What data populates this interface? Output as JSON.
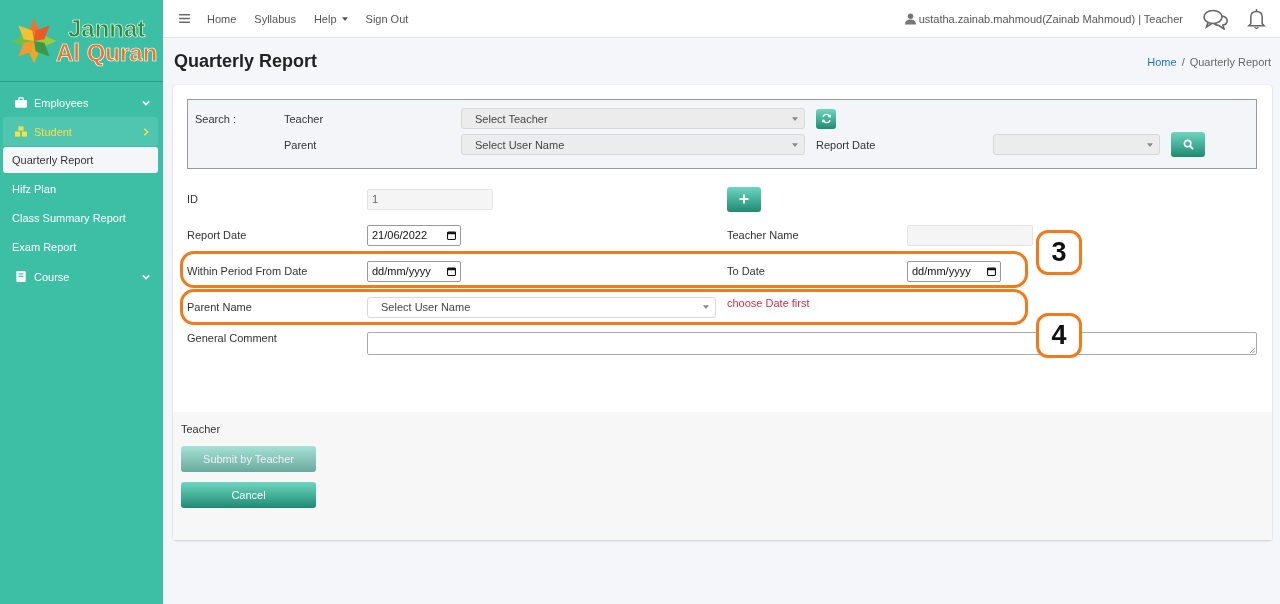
{
  "logo": {
    "line_1": "Jannat",
    "line_2": "Al Quran"
  },
  "sidebar": {
    "items": [
      {
        "label": "Employees",
        "selected": false
      },
      {
        "label": "Student",
        "selected": true,
        "children": [
          {
            "label": "Quarterly Report",
            "selected": true
          },
          {
            "label": "Hifz Plan",
            "selected": false
          },
          {
            "label": "Class Summary Report",
            "selected": false
          },
          {
            "label": "Exam Report",
            "selected": false
          }
        ]
      },
      {
        "label": "Course",
        "selected": false
      }
    ]
  },
  "topnav": {
    "items": [
      {
        "label": "Home",
        "dropdown": false
      },
      {
        "label": "Syllabus",
        "dropdown": false
      },
      {
        "label": "Help",
        "dropdown": true
      },
      {
        "label": "Sign Out",
        "dropdown": false
      }
    ],
    "user": "ustatha.zainab.mahmoud(Zainab Mahmoud) | Teacher"
  },
  "page_title": "Quarterly Report",
  "breadcrumb": {
    "separator": "/",
    "items": [
      {
        "label": "Home",
        "link": true
      },
      {
        "label": "Quarterly Report",
        "link": false
      }
    ]
  },
  "search": {
    "label": "Search :",
    "teacher_label": "Teacher",
    "teacher_select": "Select Teacher",
    "parent_label": "Parent",
    "parent_select": "Select User Name",
    "report_date_label": "Report Date"
  },
  "form": {
    "id_label": "ID",
    "id_value": "1",
    "report_date_label": "Report Date",
    "report_date_value": "21/06/2022",
    "teacher_name_label": "Teacher Name",
    "from_label": "Within Period From Date",
    "from_placeholder": "dd/mm/yyyy",
    "to_label": "To Date",
    "to_placeholder": "dd/mm/yyyy",
    "parent_name_label": "Parent Name",
    "parent_name_select": "Select User Name",
    "parent_name_error": "choose Date first",
    "comment_label": "General Comment"
  },
  "footer": {
    "label": "Teacher",
    "buttons": [
      {
        "label": "Submit by Teacher",
        "disabled": true
      },
      {
        "label": "Cancel",
        "disabled": false
      }
    ]
  },
  "annotations": [
    {
      "label": "3"
    },
    {
      "label": "4"
    }
  ]
}
